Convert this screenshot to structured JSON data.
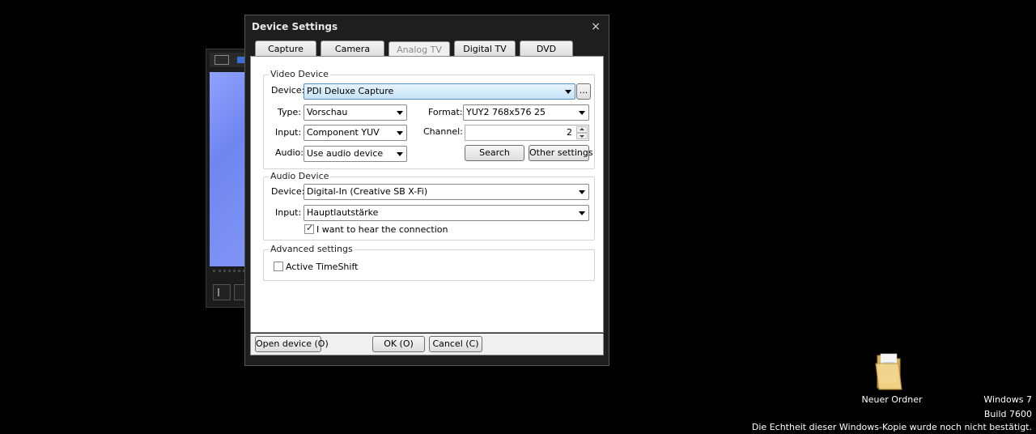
{
  "dialog": {
    "title": "Device Settings",
    "close": "×",
    "tabs": [
      "Capture",
      "Camera",
      "Analog TV",
      "Digital TV",
      "DVD"
    ],
    "active_tab": "Analog TV"
  },
  "video_device": {
    "group_title": "Video Device",
    "device_label": "Device:",
    "device_value": "PDI Deluxe Capture",
    "browse_button": "...",
    "type_label": "Type:",
    "type_value": "Vorschau",
    "format_label": "Format:",
    "format_value": "YUY2 768x576 25",
    "input_label": "Input:",
    "input_value": "Component YUV",
    "channel_label": "Channel:",
    "channel_value": "2",
    "audio_label": "Audio:",
    "audio_value": "Use audio device",
    "search_button": "Search",
    "other_settings_button": "Other settings"
  },
  "audio_device": {
    "group_title": "Audio Device",
    "device_label": "Device:",
    "device_value": "Digital-In (Creative SB X-Fi)",
    "input_label": "Input:",
    "input_value": "Hauptlautstärke",
    "hear_connection_label": "I want to hear the connection",
    "hear_connection_checked": true
  },
  "advanced": {
    "group_title": "Advanced settings",
    "timeshift_label": "Active TimeShift",
    "timeshift_checked": false
  },
  "footer": {
    "open_device": "Open device (O)",
    "ok": "OK (O)",
    "cancel": "Cancel (C)"
  },
  "desktop": {
    "folder_label": "Neuer Ordner",
    "watermark_line1": "Windows 7",
    "watermark_line2": "Build 7600",
    "watermark_line3": "Die Echtheit dieser Windows-Kopie wurde noch nicht bestätigt."
  },
  "colors": {
    "desktop_bg": "#000000",
    "dialog_frame": "#1e1e1e",
    "selected_highlight": "#c5e3f6"
  }
}
